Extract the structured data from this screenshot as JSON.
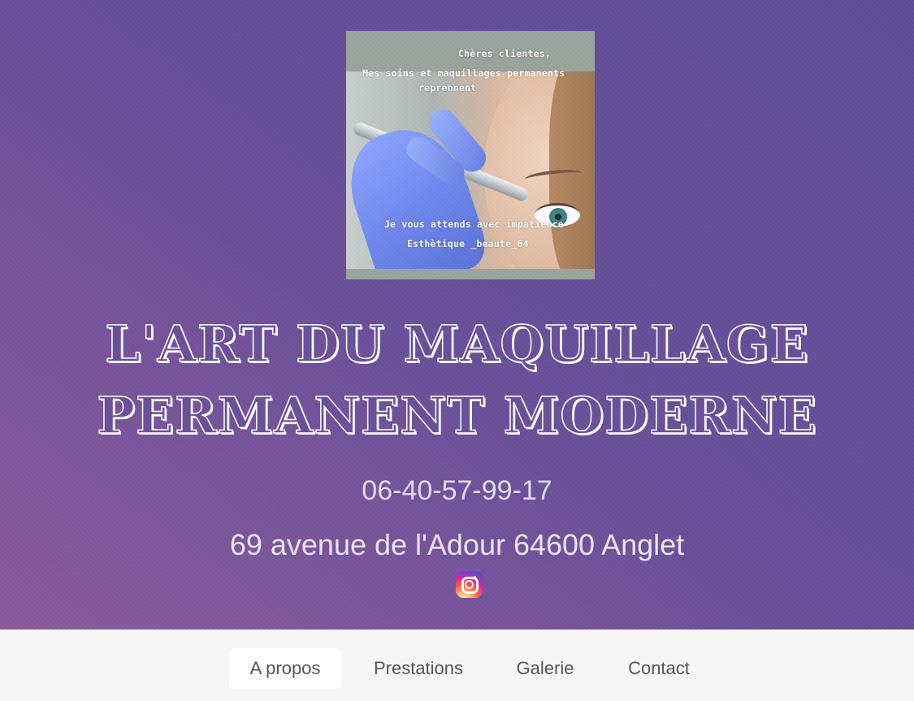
{
  "hero": {
    "photo": {
      "caption_line1": "Chères clientes,",
      "caption_line2": "Mes soins et maquillages permanents",
      "caption_line3": "reprennent",
      "caption_line4": "Je vous attends avec impatience",
      "caption_line5": "Esthètique _beaute_64"
    },
    "title_line1": "L'ART DU MAQUILLAGE",
    "title_line2": "PERMANENT MODERNE",
    "phone": "06-40-57-99-17",
    "address": "69 avenue de l'Adour 64600 Anglet",
    "social_icon": "instagram-icon",
    "colors": {
      "gradient_start": "#8a5a9c",
      "gradient_end": "#5b4e98"
    }
  },
  "nav": {
    "items": [
      {
        "label": "A propos",
        "active": true
      },
      {
        "label": "Prestations",
        "active": false
      },
      {
        "label": "Galerie",
        "active": false
      },
      {
        "label": "Contact",
        "active": false
      }
    ]
  }
}
